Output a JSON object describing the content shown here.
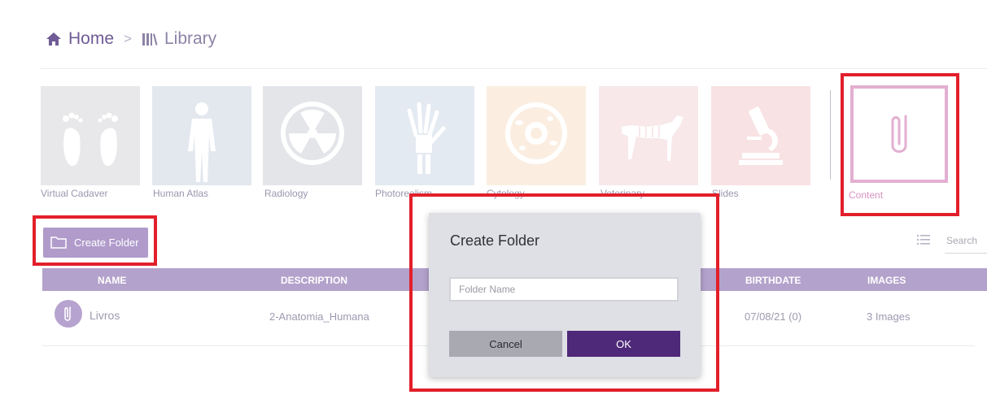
{
  "breadcrumb": {
    "home": "Home",
    "separator": ">",
    "library": "Library"
  },
  "categories": [
    {
      "label": "Virtual Cadaver",
      "icon": "feet-icon",
      "color": "#e8e8ea"
    },
    {
      "label": "Human Atlas",
      "icon": "human-body-icon",
      "color": "#e3e8ef"
    },
    {
      "label": "Radiology",
      "icon": "radiation-icon",
      "color": "#e3e5e9"
    },
    {
      "label": "Photorealism",
      "icon": "hand-xray-icon",
      "color": "#e4eaf1"
    },
    {
      "label": "Cytology",
      "icon": "cell-icon",
      "color": "#fbeee1"
    },
    {
      "label": "Veterinary",
      "icon": "dog-skeleton-icon",
      "color": "#f8e8ea"
    },
    {
      "label": "Slides",
      "icon": "microscope-icon",
      "color": "#f8e2e3"
    }
  ],
  "content_tile": {
    "label": "Content",
    "icon": "paperclip-icon",
    "color": "#e3afd1"
  },
  "toolbar": {
    "create_folder_label": "Create Folder",
    "search_placeholder": "Search"
  },
  "table": {
    "headers": [
      "NAME",
      "DESCRIPTION",
      "BIRTHDATE",
      "IMAGES"
    ],
    "rows": [
      {
        "name": "Livros",
        "description": "2-Anatomia_Humana",
        "birthdate": "07/08/21 (0)",
        "images": "3 Images"
      }
    ]
  },
  "dialog": {
    "title": "Create Folder",
    "input_placeholder": "Folder Name",
    "input_value": "",
    "cancel_label": "Cancel",
    "ok_label": "OK"
  },
  "colors": {
    "accent": "#4e2879",
    "header": "#b3a2cb",
    "button": "#b09bcb",
    "highlight": "#e21f2a"
  }
}
